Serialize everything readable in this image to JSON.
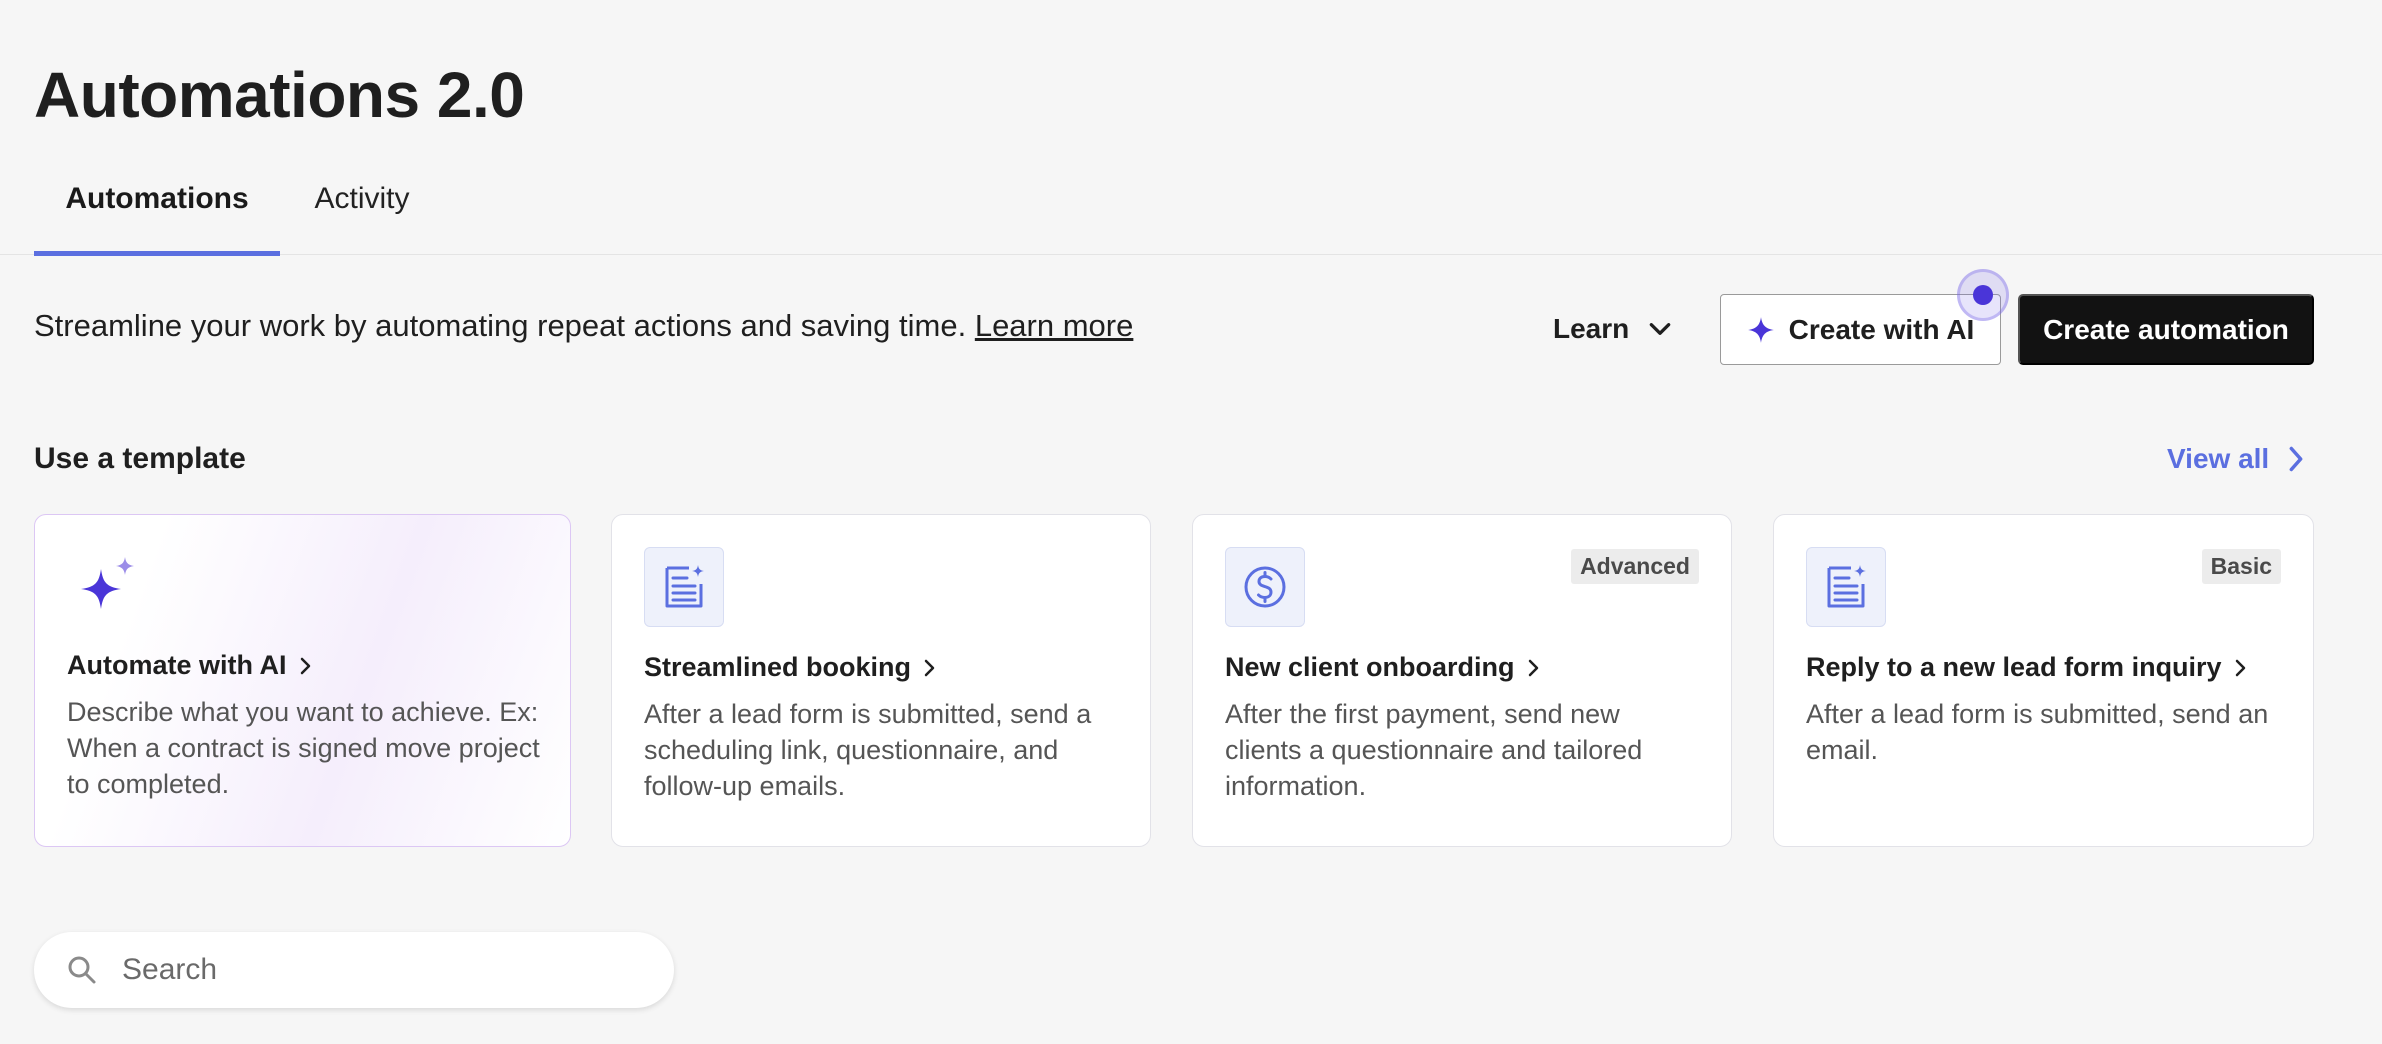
{
  "page": {
    "title": "Automations 2.0"
  },
  "tabs": [
    {
      "label": "Automations",
      "active": true
    },
    {
      "label": "Activity",
      "active": false
    }
  ],
  "intro": {
    "text": "Streamline your work by automating repeat actions and saving time.",
    "link_label": "Learn more"
  },
  "toolbar": {
    "learn_label": "Learn",
    "create_ai_label": "Create with AI",
    "create_label": "Create automation"
  },
  "templates": {
    "section_title": "Use a template",
    "view_all_label": "View all",
    "cards": [
      {
        "icon": "sparkles-icon",
        "title": "Automate with AI",
        "description": "Describe what you want to achieve. Ex: When a contract is signed move project to completed.",
        "badge": ""
      },
      {
        "icon": "form-sparkle-icon",
        "title": "Streamlined booking",
        "description": "After a lead form is submitted, send a scheduling link, questionnaire, and follow-up emails.",
        "badge": ""
      },
      {
        "icon": "dollar-circle-icon",
        "title": "New client onboarding",
        "description": "After the first payment, send new clients a questionnaire and tailored information.",
        "badge": "Advanced"
      },
      {
        "icon": "form-sparkle-icon",
        "title": "Reply to a new lead form inquiry",
        "description": "After a lead form is submitted, send an email.",
        "badge": "Basic"
      }
    ]
  },
  "search": {
    "placeholder": "Search",
    "value": ""
  },
  "colors": {
    "accent": "#5b6fe0",
    "ai_purple": "#4a35d8",
    "primary_button": "#121212",
    "background": "#f6f6f6"
  }
}
